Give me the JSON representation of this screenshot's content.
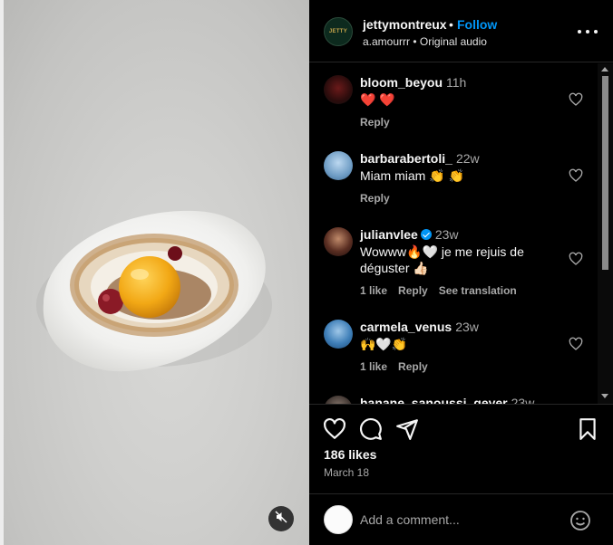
{
  "header": {
    "username": "jettymontreux",
    "separator": "•",
    "follow_label": "Follow",
    "audio_text": "a.amourrr • Original audio",
    "logo_text": "JETTY"
  },
  "comments": [
    {
      "username": "bloom_beyou",
      "time": "11h",
      "text": "❤️ ❤️",
      "verified": false,
      "actions": [
        "Reply"
      ]
    },
    {
      "username": "barbarabertoli_",
      "time": "22w",
      "text": "Miam miam 👏 👏",
      "verified": false,
      "actions": [
        "Reply"
      ]
    },
    {
      "username": "julianvlee",
      "time": "23w",
      "text": "Wowww🔥🤍 je me rejuis de déguster 👍🏻",
      "verified": true,
      "actions": [
        "1 like",
        "Reply",
        "See translation"
      ]
    },
    {
      "username": "carmela_venus",
      "time": "23w",
      "text": "🙌🤍👏",
      "verified": false,
      "actions": [
        "1 like",
        "Reply"
      ]
    },
    {
      "username": "hanane_sanoussi_geyer",
      "time": "23w",
      "text": "",
      "verified": false,
      "actions": []
    }
  ],
  "likes": "186 likes",
  "date": "March 18",
  "add_comment": {
    "placeholder": "Add a comment..."
  },
  "icons": {
    "like": "heart-icon",
    "comment": "comment-icon",
    "share": "share-icon",
    "save": "bookmark-icon",
    "mute": "speaker-muted-icon",
    "more": "more-options-icon",
    "emoji": "emoji-icon"
  },
  "colors": {
    "follow": "#0095f6",
    "background": "#000000",
    "secondary_text": "#a8a8a8"
  }
}
